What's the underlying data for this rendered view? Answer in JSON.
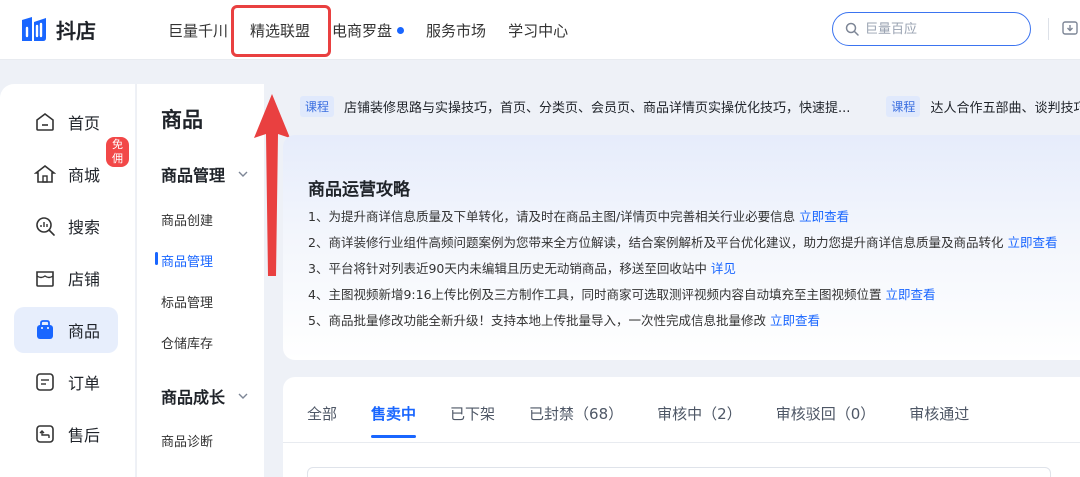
{
  "app": {
    "logo_text": "抖店"
  },
  "nav": {
    "items": [
      {
        "label": "巨量千川"
      },
      {
        "label": "精选联盟"
      },
      {
        "label": "电商罗盘"
      },
      {
        "label": "服务市场"
      },
      {
        "label": "学习中心"
      }
    ],
    "search_placeholder": "巨量百应"
  },
  "sidebar": {
    "items": [
      {
        "label": "首页"
      },
      {
        "label": "商城",
        "badge": "免佣"
      },
      {
        "label": "搜索"
      },
      {
        "label": "店铺"
      },
      {
        "label": "商品"
      },
      {
        "label": "订单"
      },
      {
        "label": "售后"
      }
    ]
  },
  "subbar": {
    "title": "商品",
    "group1": "商品管理",
    "links1": [
      "商品创建",
      "商品管理",
      "标品管理",
      "仓储库存"
    ],
    "group2": "商品成长",
    "links2": [
      "商品诊断"
    ]
  },
  "ticker": {
    "tag": "课程",
    "text1": "店铺装修思路与实操技巧，首页、分类页、会员页、商品详情页实操优化技巧，快速提...",
    "text2": "达人合作五部曲、谈判技巧"
  },
  "guide": {
    "title": "商品运营攻略",
    "items": [
      {
        "text": "1、为提升商详信息质量及下单转化，请及时在商品主图/详情页中完善相关行业必要信息",
        "link": "立即查看"
      },
      {
        "text": "2、商详装修行业组件高频问题案例为您带来全方位解读，结合案例解析及平台优化建议，助力您提升商详信息质量及商品转化",
        "link": "立即查看"
      },
      {
        "text": "3、平台将针对列表近90天内未编辑且历史无动销商品，移送至回收站中",
        "link": "详见"
      },
      {
        "text": "4、主图视频新增9:16上传比例及三方制作工具，同时商家可选取测评视频内容自动填充至主图视频位置",
        "link": "立即查看"
      },
      {
        "text": "5、商品批量修改功能全新升级！支持本地上传批量导入，一次性完成信息批量修改",
        "link": "立即查看"
      }
    ]
  },
  "tabs": [
    {
      "label": "全部"
    },
    {
      "label": "售卖中"
    },
    {
      "label": "已下架"
    },
    {
      "label": "已封禁（68）"
    },
    {
      "label": "审核中（2）"
    },
    {
      "label": "审核驳回（0）"
    },
    {
      "label": "审核通过"
    }
  ],
  "colors": {
    "accent": "#1966ff",
    "highlight": "#e94040",
    "badge": "#f24848"
  }
}
